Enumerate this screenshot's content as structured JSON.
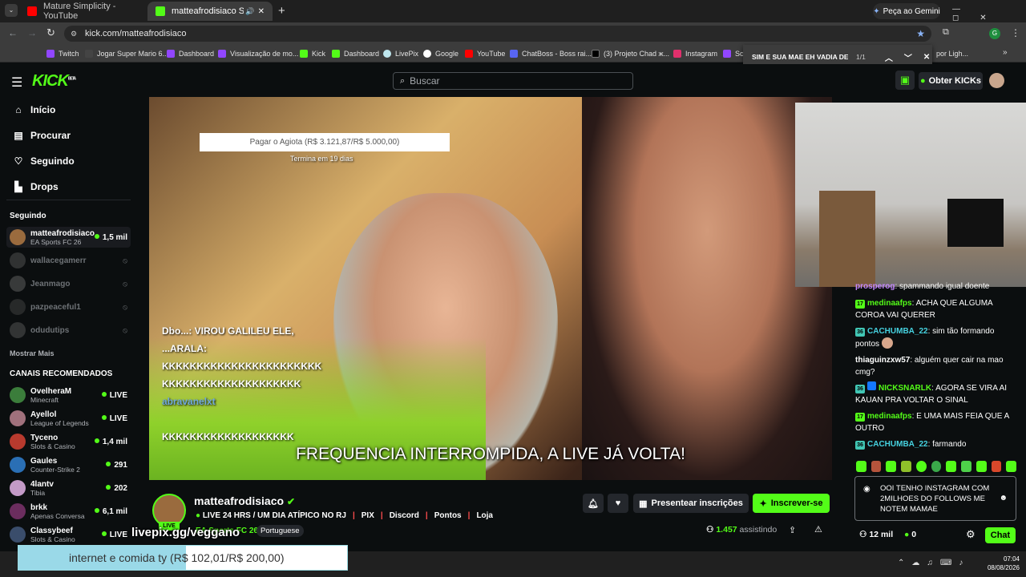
{
  "browser": {
    "tabs": [
      {
        "title": "Mature Simplicity - YouTube"
      },
      {
        "title": "matteafrodisiaco Stream - "
      }
    ],
    "gemini_label": "Peça ao Gemini",
    "url": "kick.com/matteafrodisiaco",
    "bookmarks": [
      "Twitch",
      "Jogar Super Mario 6...",
      "Dashboard",
      "Visualização de mo...",
      "Kick",
      "Dashboard",
      "LivePix",
      "Google",
      "YouTube",
      "ChatBoss - Boss rai...",
      "(3) Projeto Chad ж...",
      "Instagram",
      "Scr",
      "por Ligh..."
    ],
    "find": {
      "query": "SIM E SUA MAE EH VADIA DE",
      "count": "1/1"
    }
  },
  "kick": {
    "logo": "KICK",
    "beta": "BETA",
    "search_placeholder": "Buscar",
    "get_kicks": "Obter KICKs"
  },
  "sidebar": {
    "nav": [
      {
        "label": "Início",
        "icon": "home-icon"
      },
      {
        "label": "Procurar",
        "icon": "browse-icon"
      },
      {
        "label": "Seguindo",
        "icon": "heart-icon"
      },
      {
        "label": "Drops",
        "icon": "drops-icon"
      }
    ],
    "following_title": "Seguindo",
    "following": [
      {
        "name": "matteafrodisiaco",
        "game": "EA Sports FC 26",
        "viewers": "1,5 mil",
        "live": true
      },
      {
        "name": "wallacegamerr",
        "live": false
      },
      {
        "name": "Jeanmago",
        "live": false
      },
      {
        "name": "pazpeaceful1",
        "live": false
      },
      {
        "name": "odudutips",
        "live": false
      }
    ],
    "show_more": "Mostrar Mais",
    "recommended_title": "CANAIS RECOMENDADOS",
    "recommended": [
      {
        "name": "OvelheraM",
        "game": "Minecraft",
        "viewers": "LIVE"
      },
      {
        "name": "Ayellol",
        "game": "League of Legends",
        "viewers": "LIVE"
      },
      {
        "name": "Tyceno",
        "game": "Slots & Casino",
        "viewers": "1,4 mil"
      },
      {
        "name": "Gaules",
        "game": "Counter-Strike 2",
        "viewers": "291"
      },
      {
        "name": "4lantv",
        "game": "Tibia",
        "viewers": "202"
      },
      {
        "name": "brkk",
        "game": "Apenas Conversa",
        "viewers": "6,1 mil"
      },
      {
        "name": "Classybeef",
        "game": "Slots & Casino",
        "viewers": "LIVE"
      }
    ]
  },
  "video": {
    "goal_text": "Pagar o Agiota (R$ 3.121,87/R$ 5.000,00)",
    "goal_progress": 0.62,
    "goal_sub": "Termina em 19 dias",
    "overlay_chat": [
      "Dbo...: VIROU GALILEU ELE,",
      "...ARALA:",
      "KKKKKKKKKKKKKKKKKKKKKKK",
      "KKKKKKKKKKKKKKKKKKKK",
      "abravanelxt",
      "KKKKKKKKKKKKKKKKKKK"
    ],
    "subtitle": "FREQUENCIA INTERROMPIDA, A LIVE JÁ VOLTA!"
  },
  "channel": {
    "name": "matteafrodisiaco",
    "live_badge": "LIVE",
    "title": "LIVE 24 HRS / UM DIA ATÍPICO NO RJ",
    "links": [
      "PIX",
      "Discord",
      "Pontos",
      "Loja"
    ],
    "category": "EA Sports FC 26",
    "language": "Portuguese",
    "gift_label": "Presentear inscrições",
    "subscribe_label": "Inscrever-se",
    "viewers": "1.457",
    "viewers_label": "assistindo"
  },
  "chat": {
    "messages": [
      {
        "badge": "",
        "user": "prosperog",
        "text": ": spammando igual doente"
      },
      {
        "badge": "17",
        "user": "medinaafps",
        "text": ": ACHA QUE ALGUMA COROA VAI QUERER"
      },
      {
        "badge": "36",
        "user": "CACHUMBA_22",
        "text": ": sim tão formando pontos"
      },
      {
        "badge": "",
        "user": "thiaguinzxw57",
        "text": ": alguém quer cair na mao cmg?"
      },
      {
        "badge": "36",
        "user": "NICKSNARLK",
        "text": ": AGORA SE VIRA AI KAUAN PRA VOLTAR O SINAL"
      },
      {
        "badge": "17",
        "user": "medinaafps",
        "text": ": E UMA MAIS FEIA QUE A OUTRO"
      },
      {
        "badge": "36",
        "user": "CACHUMBA_22",
        "text": ": farmando"
      }
    ],
    "input_text": "OOI TENHO INSTAGRAM COM 2MILHOES DO FOLLOWS  ME NOTEM MAMAE",
    "followers": "12 mil",
    "kicks": "0",
    "send_label": "Chat"
  },
  "livepix": {
    "url": "livepix.gg/veggano",
    "goal_label": "internet e comida ty (R$ 102,01/R$ 200,00)",
    "progress": 0.51
  },
  "taskbar": {
    "time": "07:04",
    "date": "08/08/2026"
  },
  "colors": {
    "kick_green": "#53fc18",
    "background": "#0b0e0f",
    "goal_orange": "#f47d20"
  }
}
